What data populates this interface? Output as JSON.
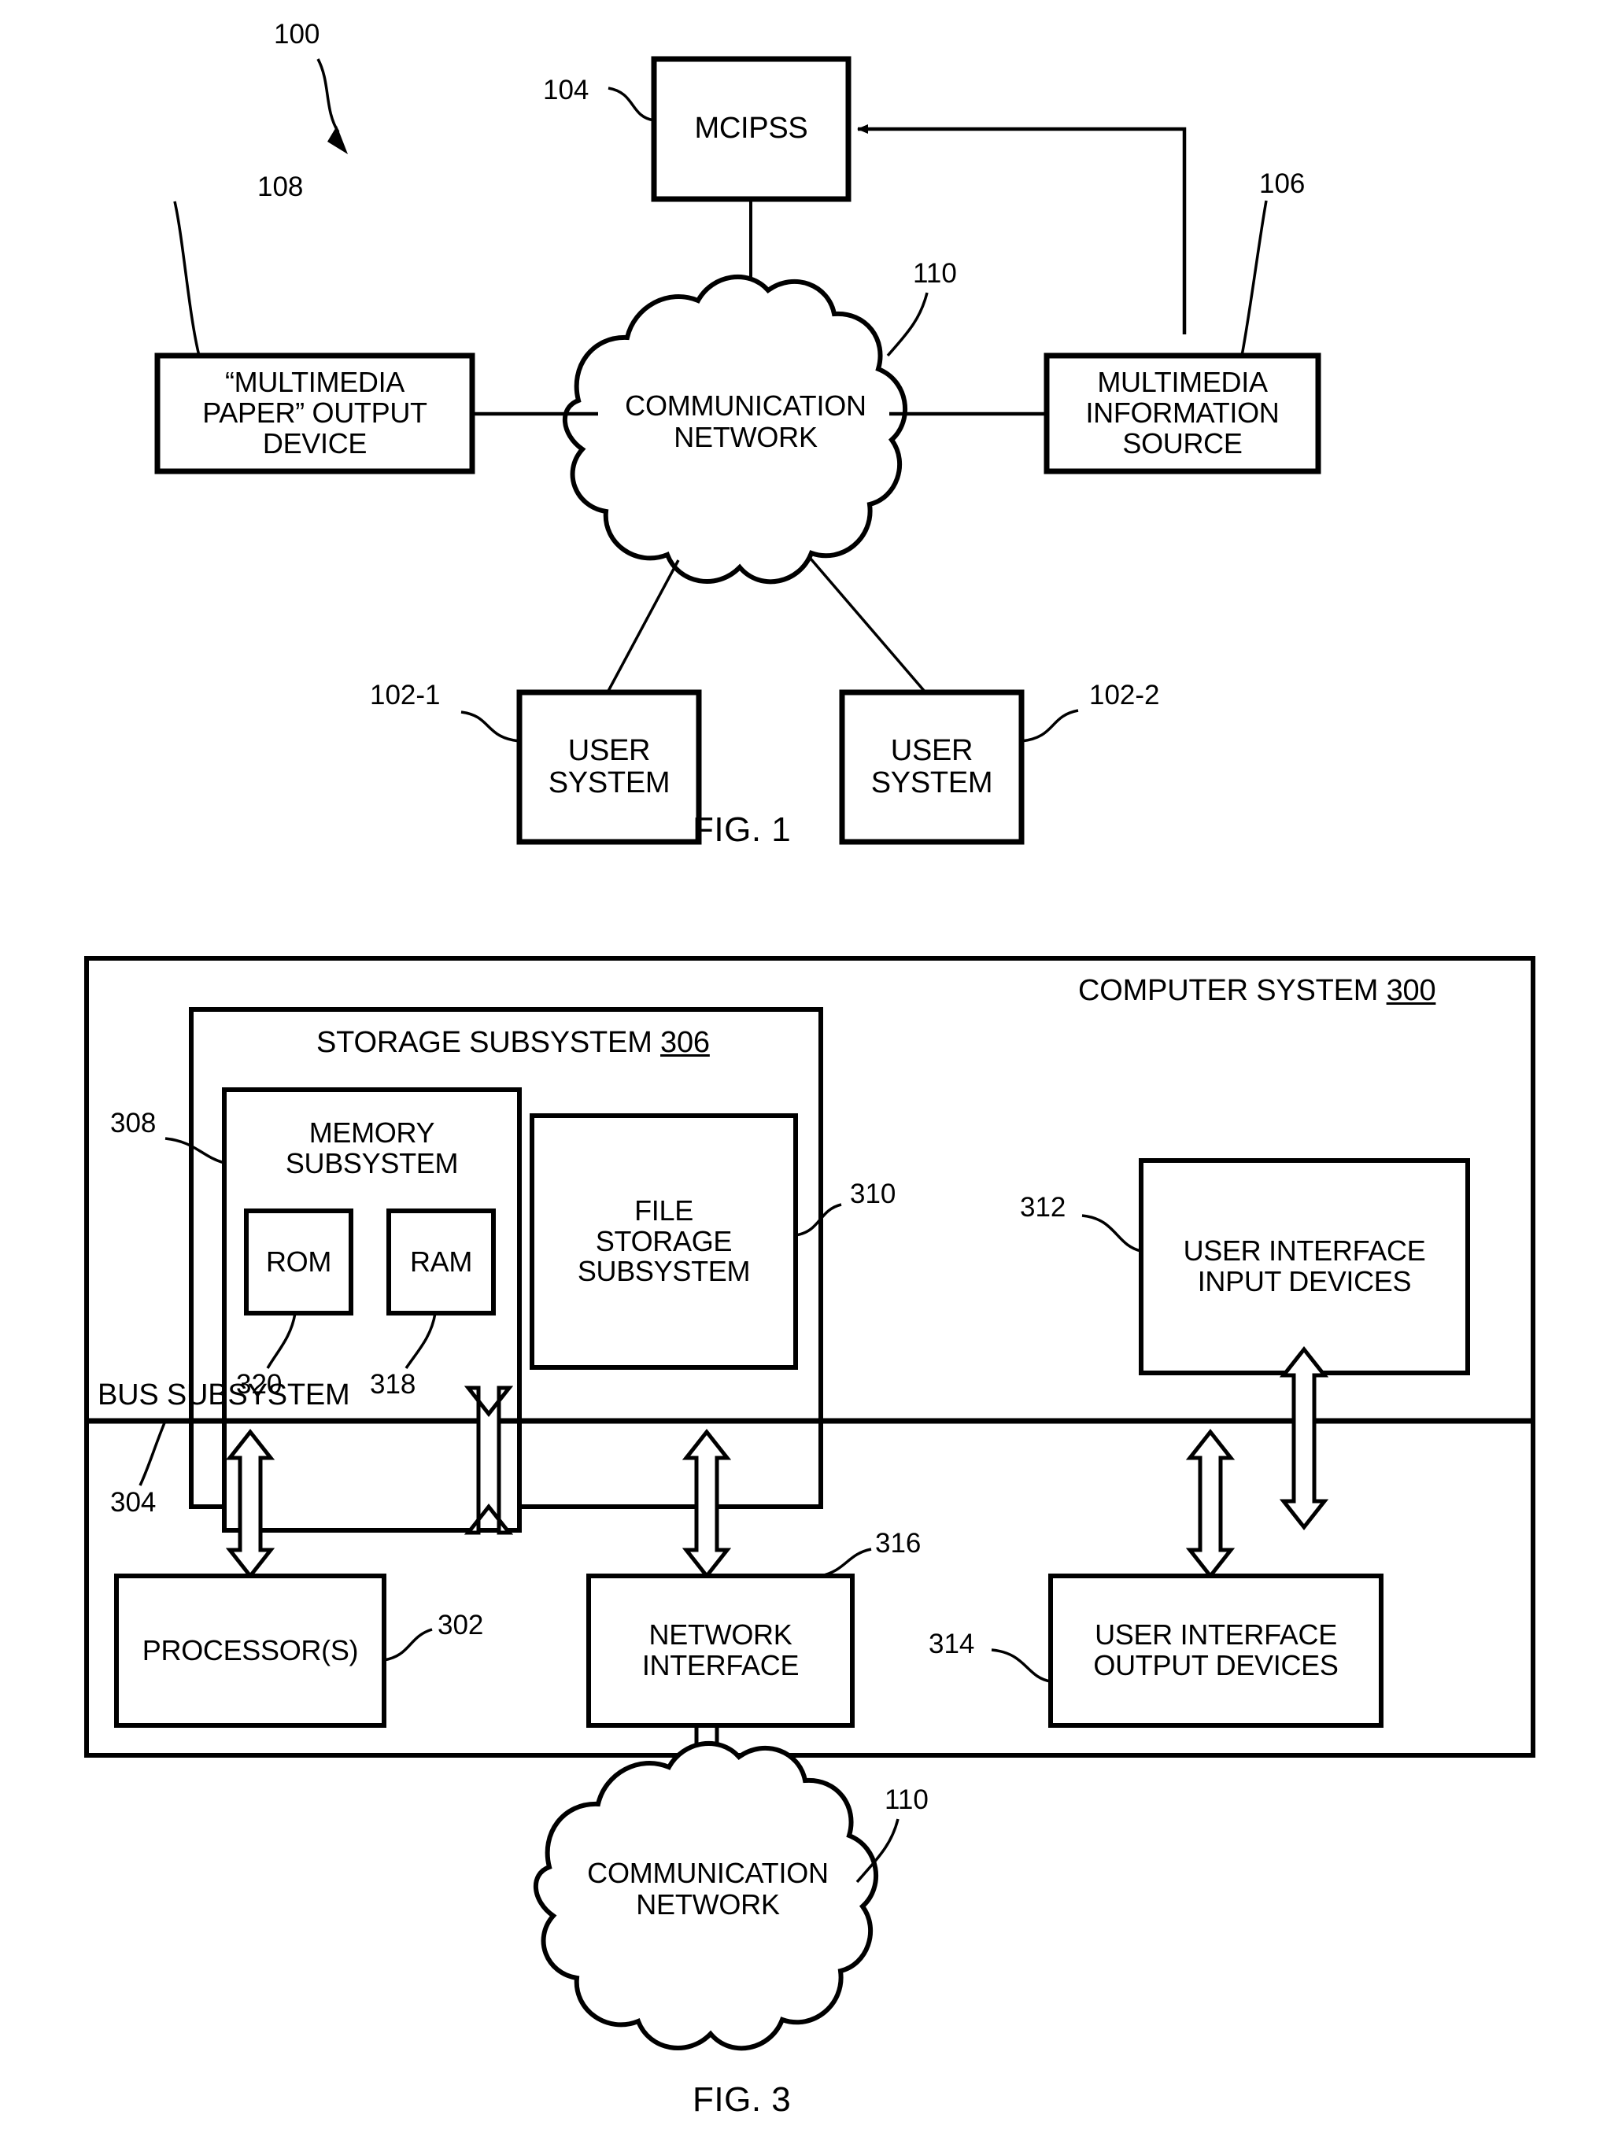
{
  "figures": [
    {
      "id": "fig1",
      "caption": "FIG. 1",
      "system_ref": "100",
      "nodes": {
        "mcipss": {
          "label": "MCIPSS",
          "ref": "104"
        },
        "multimedia_paper_output_device": {
          "label": "“MULTIMEDIA\nPAPER” OUTPUT\nDEVICE",
          "ref": "108"
        },
        "communication_network": {
          "label": "COMMUNICATION\nNETWORK",
          "ref": "110"
        },
        "multimedia_information_source": {
          "label": "MULTIMEDIA\nINFORMATION\nSOURCE",
          "ref": "106"
        },
        "user_system_1": {
          "label": "USER\nSYSTEM",
          "ref": "102-1"
        },
        "user_system_2": {
          "label": "USER\nSYSTEM",
          "ref": "102-2"
        }
      }
    },
    {
      "id": "fig3",
      "caption": "FIG. 3",
      "nodes": {
        "computer_system": {
          "label": "COMPUTER SYSTEM ",
          "ref": "300"
        },
        "storage_subsystem": {
          "label": "STORAGE SUBSYSTEM ",
          "ref": "306"
        },
        "memory_subsystem": {
          "label": "MEMORY\nSUBSYSTEM",
          "ref": "308"
        },
        "rom": {
          "label": "ROM",
          "ref": "320"
        },
        "ram": {
          "label": "RAM",
          "ref": "318"
        },
        "file_storage_subsystem": {
          "label": "FILE\nSTORAGE\nSUBSYSTEM",
          "ref": "310"
        },
        "user_interface_input_devices": {
          "label": "USER INTERFACE\nINPUT DEVICES",
          "ref": "312"
        },
        "bus_subsystem": {
          "label": "BUS SUBSYSTEM",
          "ref": "304"
        },
        "processors": {
          "label": "PROCESSOR(S)",
          "ref": "302"
        },
        "network_interface": {
          "label": "NETWORK\nINTERFACE",
          "ref": "316"
        },
        "user_interface_output_devices": {
          "label": "USER INTERFACE\nOUTPUT DEVICES",
          "ref": "314"
        },
        "communication_network": {
          "label": "COMMUNICATION\nNETWORK",
          "ref": "110"
        }
      }
    }
  ],
  "colors": {
    "ink": "#000000",
    "paper": "#ffffff"
  }
}
